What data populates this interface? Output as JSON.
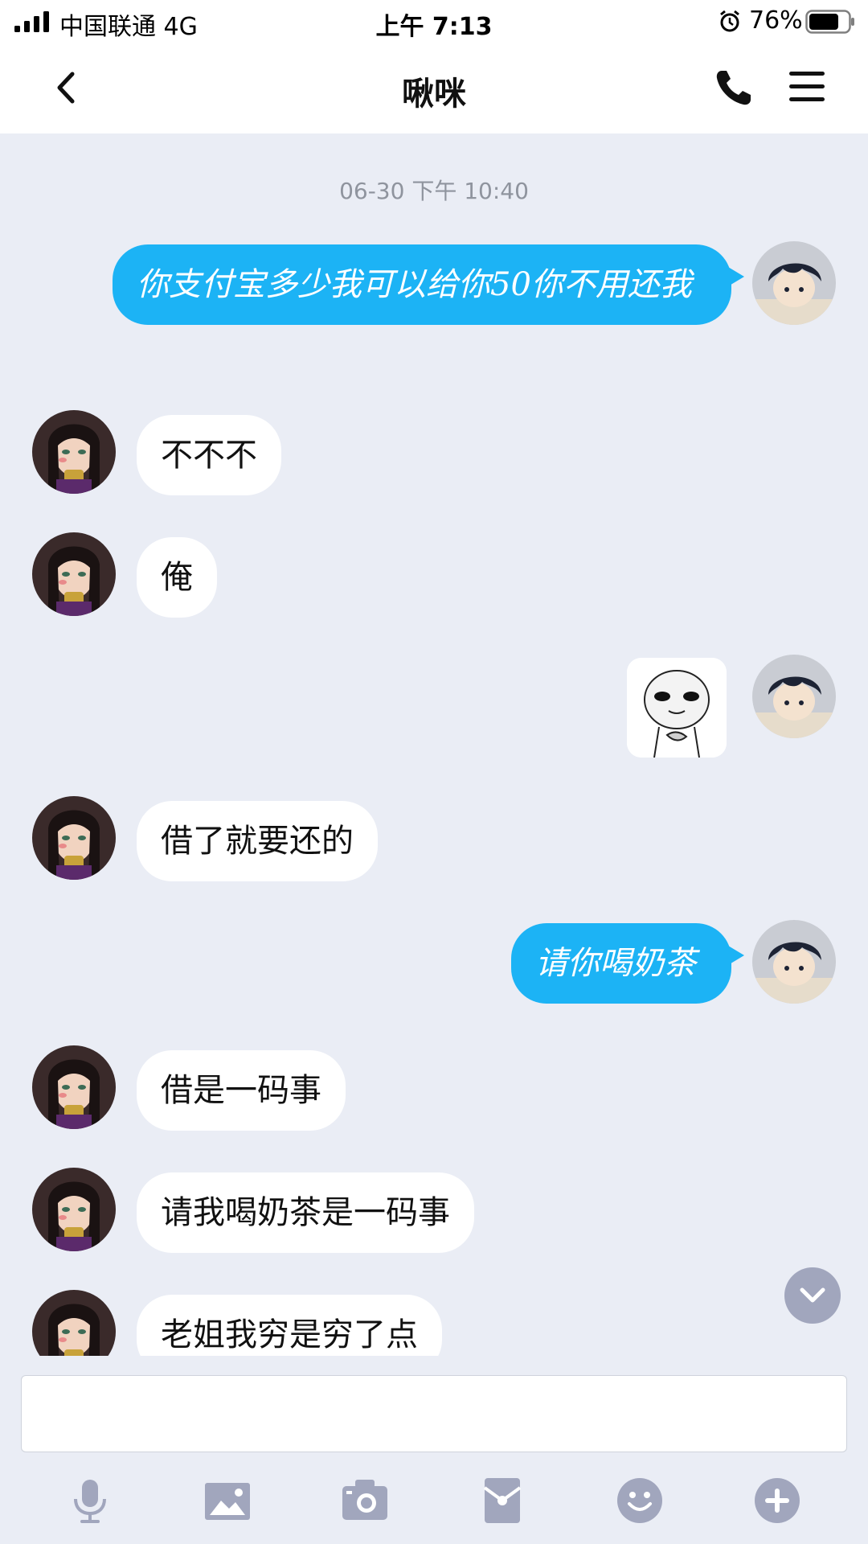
{
  "status_bar": {
    "carrier": "中国联通   4G",
    "time": "上午 7:13",
    "battery_percent": "76%",
    "battery_level": 0.76,
    "icons": [
      "signal-icon",
      "alarm-icon",
      "battery-icon"
    ]
  },
  "header": {
    "title": "啾咪",
    "icons": [
      "back-icon",
      "phone-icon",
      "menu-icon"
    ]
  },
  "chat": {
    "timestamp": "06-30 下午 10:40",
    "messages": [
      {
        "side": "out",
        "type": "text",
        "text": "你支付宝多少我可以给你50你不用还我"
      },
      {
        "side": "in",
        "type": "text",
        "text": "不不不"
      },
      {
        "side": "in",
        "type": "text",
        "text": "俺"
      },
      {
        "side": "out",
        "type": "sticker",
        "sticker": "staring-face-sticker"
      },
      {
        "side": "in",
        "type": "text",
        "text": "借了就要还的"
      },
      {
        "side": "out",
        "type": "text",
        "text": "请你喝奶茶"
      },
      {
        "side": "in",
        "type": "text",
        "text": "借是一码事"
      },
      {
        "side": "in",
        "type": "text",
        "text": "请我喝奶茶是一码事"
      },
      {
        "side": "in",
        "type": "text",
        "text": "老姐我穷是穷了点"
      }
    ]
  },
  "input": {
    "value": "",
    "placeholder": ""
  },
  "toolbar": {
    "icons": [
      "microphone-icon",
      "image-icon",
      "camera-icon",
      "red-packet-icon",
      "emoji-icon",
      "plus-icon"
    ]
  },
  "colors": {
    "background": "#eaedf5",
    "outgoing_bubble": "#1cb3f5",
    "incoming_bubble": "#ffffff",
    "toolbar_icon": "#a1a6bd"
  }
}
